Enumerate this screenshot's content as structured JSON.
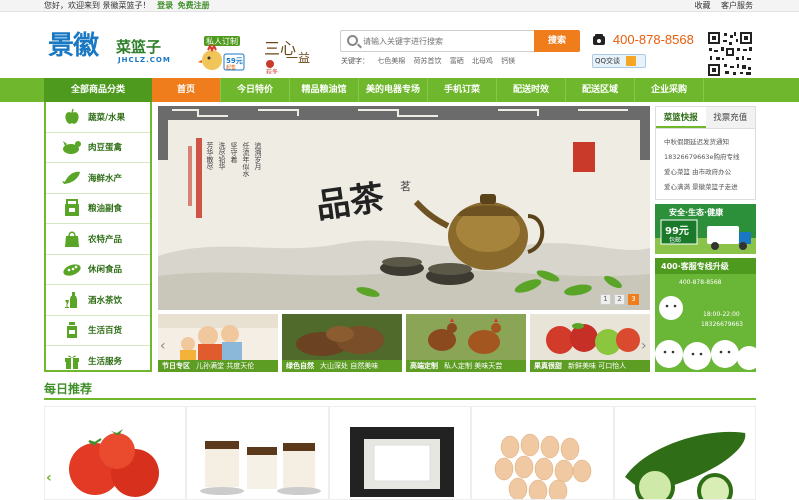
{
  "topbar": {
    "welcome": "您好，欢迎来到 景徽菜篮子！",
    "login": "登录",
    "register": "免费注册",
    "favorite": "收藏",
    "service": "客户服务"
  },
  "logo": {
    "zh": "景徽",
    "zh2": "菜篮子",
    "en": "JHCLZ.COM"
  },
  "search": {
    "placeholder": "请输入关键字进行搜索",
    "button": "搜索",
    "hot_label": "关键字：",
    "hot": [
      "七色美棉",
      "荷苏首饮",
      "富硒",
      "北母鸡",
      "钙镁"
    ]
  },
  "contact": {
    "phone": "400-878-8568",
    "qq": "QQ交谈"
  },
  "nav": {
    "category_title": "全部商品分类",
    "items": [
      "首页",
      "今日特价",
      "精品粮油馆",
      "美的电器专场",
      "手机订菜",
      "配送时效",
      "配送区域",
      "企业采购"
    ]
  },
  "categories": [
    {
      "label": "蔬菜/水果",
      "icon": "apple-icon"
    },
    {
      "label": "肉豆蛋禽",
      "icon": "chicken-icon"
    },
    {
      "label": "海鲜水产",
      "icon": "fish-icon"
    },
    {
      "label": "粮油副食",
      "icon": "grain-bag-icon"
    },
    {
      "label": "农特产品",
      "icon": "gift-bag-icon"
    },
    {
      "label": "休闲食品",
      "icon": "snack-icon"
    },
    {
      "label": "酒水茶饮",
      "icon": "wine-icon"
    },
    {
      "label": "生活百货",
      "icon": "bottle-icon"
    },
    {
      "label": "生活服务",
      "icon": "gift-box-icon"
    }
  ],
  "banner": {
    "title": "品茶",
    "title_small": "茗",
    "poem": [
      "追溯岁月",
      "任流年似水",
      "坚守着",
      "洗尽铅华",
      "芳华散尽"
    ],
    "pages": [
      "1",
      "2",
      "3"
    ],
    "active_page": "3"
  },
  "thumbs": [
    {
      "title": "节日专区",
      "sub": "儿孙满堂 共度天伦"
    },
    {
      "title": "绿色自然",
      "sub": "大山深处 自然美味"
    },
    {
      "title": "高端定制",
      "sub": "私人定制 美味天尝"
    },
    {
      "title": "果真很甜",
      "sub": "新鲜美味 可口怡人"
    }
  ],
  "news": {
    "tab_active": "菜篮快报",
    "tab_other": "找票充值",
    "items": [
      "中秋假期延迟发货通知",
      "18326679663e购府专线",
      "爱心菜篮 由市政府办公",
      "爱心满满 景徽菜篮子走进"
    ]
  },
  "ad_delivery": {
    "slogan": "安全·生态·健康",
    "price": "99元",
    "unit": "包邮"
  },
  "ad_hotline": {
    "title": "400·客服专线升级",
    "phone": "400-878-8568",
    "time": "18:00-22:00",
    "mobile": "18326679663"
  },
  "daily": {
    "title": "每日推荐"
  },
  "products": [
    {
      "name": "tomato"
    },
    {
      "name": "tofu-dish"
    },
    {
      "name": "tofu"
    },
    {
      "name": "eggs"
    },
    {
      "name": "cucumber"
    }
  ],
  "colors": {
    "green": "#6fb82d",
    "dark_green": "#4e9a1e",
    "orange": "#f07d1c",
    "blue": "#1a78c2"
  }
}
